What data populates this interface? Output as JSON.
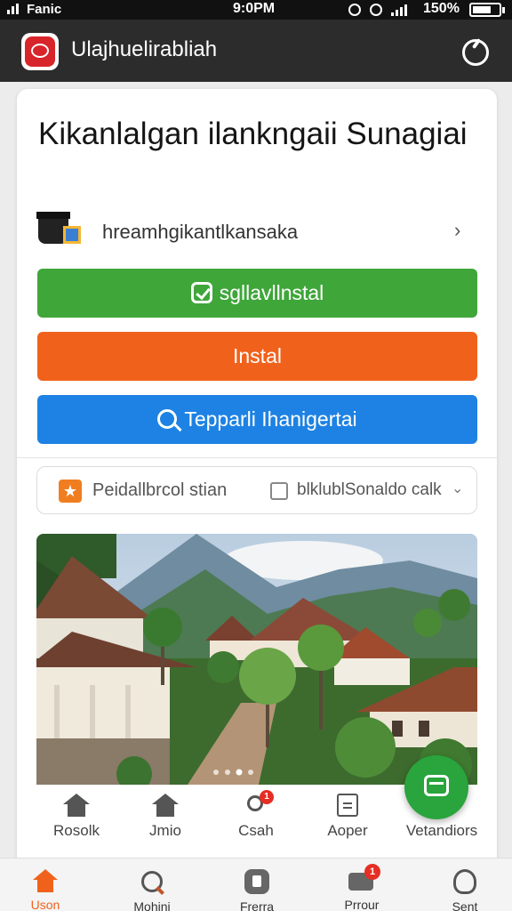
{
  "status_bar": {
    "carrier": "Fanic",
    "time": "9:0PM",
    "battery": "150%"
  },
  "app_bar": {
    "title": "Ulajhuelirabliah"
  },
  "main": {
    "heading": "Kikanlalgan ilankngaii Sunagiai",
    "publisher": "hreamhgikantlkansaka",
    "buttons": {
      "primary": "sgllavllnstal",
      "install": "Instal",
      "search": "Tepparli Ihanigertai"
    },
    "tags": {
      "rating": "Peidallbrcol stian",
      "category": "blklublSonaldo calk"
    },
    "tabs": [
      {
        "label": "Rosolk"
      },
      {
        "label": "Jmio"
      },
      {
        "label": "Csah"
      },
      {
        "label": "Aoper"
      },
      {
        "label": "Vetandiors"
      }
    ],
    "carousel": {
      "pages": 4,
      "active": 2
    }
  },
  "bottom_nav": [
    {
      "label": "Uson",
      "active": true
    },
    {
      "label": "Mohini"
    },
    {
      "label": "Frerra"
    },
    {
      "label": "Prrour"
    },
    {
      "label": "Sent"
    }
  ],
  "icons": [
    "signal-icon",
    "app-logo-icon",
    "power-icon",
    "graduation-cap-icon",
    "chevron-right-icon",
    "check-icon",
    "search-icon",
    "star-icon",
    "checkbox-icon",
    "chevron-down-icon",
    "home-icon",
    "chat-icon",
    "document-icon",
    "message-icon",
    "settings-icon"
  ],
  "colors": {
    "green": "#3fa63a",
    "orange": "#f0621c",
    "blue": "#1d82e3",
    "appbar": "#2c2c2c",
    "fab": "#2aa43c"
  }
}
